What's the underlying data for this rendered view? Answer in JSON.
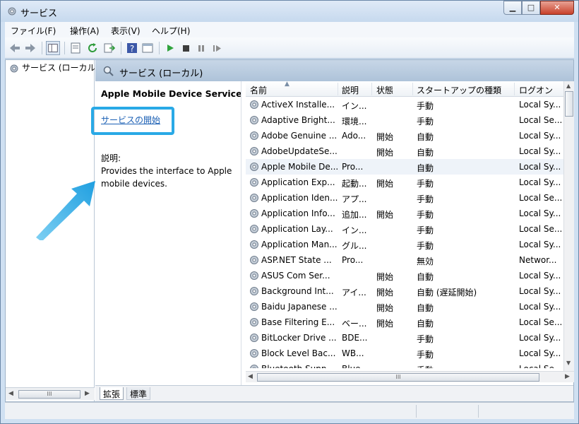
{
  "window": {
    "title": "サービス"
  },
  "menu": [
    "ファイル(F)",
    "操作(A)",
    "表示(V)",
    "ヘルプ(H)"
  ],
  "tree": {
    "item": "サービス (ローカル)"
  },
  "header": {
    "title": "サービス (ローカル)"
  },
  "description": {
    "service_name": "Apple Mobile Device Service",
    "start_link": "サービスの開始",
    "label": "説明:",
    "text": "Provides the interface to Apple mobile devices."
  },
  "columns": {
    "name": "名前",
    "desc": "説明",
    "status": "状態",
    "startup": "スタートアップの種類",
    "logon": "ログオン"
  },
  "services": [
    {
      "name": "ActiveX Installe...",
      "desc": "イン...",
      "status": "",
      "startup": "手動",
      "logon": "Local Sy..."
    },
    {
      "name": "Adaptive Bright...",
      "desc": "環境...",
      "status": "",
      "startup": "手動",
      "logon": "Local Se..."
    },
    {
      "name": "Adobe Genuine ...",
      "desc": "Ado...",
      "status": "開始",
      "startup": "自動",
      "logon": "Local Sy..."
    },
    {
      "name": "AdobeUpdateSe...",
      "desc": "",
      "status": "開始",
      "startup": "自動",
      "logon": "Local Sy..."
    },
    {
      "name": "Apple Mobile De...",
      "desc": "Pro...",
      "status": "",
      "startup": "自動",
      "logon": "Local Sy..."
    },
    {
      "name": "Application Exp...",
      "desc": "起動...",
      "status": "開始",
      "startup": "手動",
      "logon": "Local Sy..."
    },
    {
      "name": "Application Iden...",
      "desc": "アプ...",
      "status": "",
      "startup": "手動",
      "logon": "Local Se..."
    },
    {
      "name": "Application Info...",
      "desc": "追加...",
      "status": "開始",
      "startup": "手動",
      "logon": "Local Sy..."
    },
    {
      "name": "Application Lay...",
      "desc": "イン...",
      "status": "",
      "startup": "手動",
      "logon": "Local Se..."
    },
    {
      "name": "Application Man...",
      "desc": "グル...",
      "status": "",
      "startup": "手動",
      "logon": "Local Sy..."
    },
    {
      "name": "ASP.NET State ...",
      "desc": "Pro...",
      "status": "",
      "startup": "無効",
      "logon": "Networ..."
    },
    {
      "name": "ASUS Com Ser...",
      "desc": "",
      "status": "開始",
      "startup": "自動",
      "logon": "Local Sy..."
    },
    {
      "name": "Background Int...",
      "desc": "アイ...",
      "status": "開始",
      "startup": "自動 (遅延開始)",
      "logon": "Local Sy..."
    },
    {
      "name": "Baidu Japanese ...",
      "desc": "",
      "status": "開始",
      "startup": "自動",
      "logon": "Local Sy..."
    },
    {
      "name": "Base Filtering E...",
      "desc": "ベー...",
      "status": "開始",
      "startup": "自動",
      "logon": "Local Se..."
    },
    {
      "name": "BitLocker Drive ...",
      "desc": "BDE...",
      "status": "",
      "startup": "手動",
      "logon": "Local Sy..."
    },
    {
      "name": "Block Level Bac...",
      "desc": "WB...",
      "status": "",
      "startup": "手動",
      "logon": "Local Sy..."
    },
    {
      "name": "Bluetooth Supp...",
      "desc": "Blue...",
      "status": "",
      "startup": "手動",
      "logon": "Local Se..."
    }
  ],
  "tabs": {
    "extended": "拡張",
    "standard": "標準"
  },
  "scroll": {
    "thumb_glyph": "III"
  },
  "colors": {
    "highlight": "#29a9e6",
    "link": "#1a5fb4"
  }
}
